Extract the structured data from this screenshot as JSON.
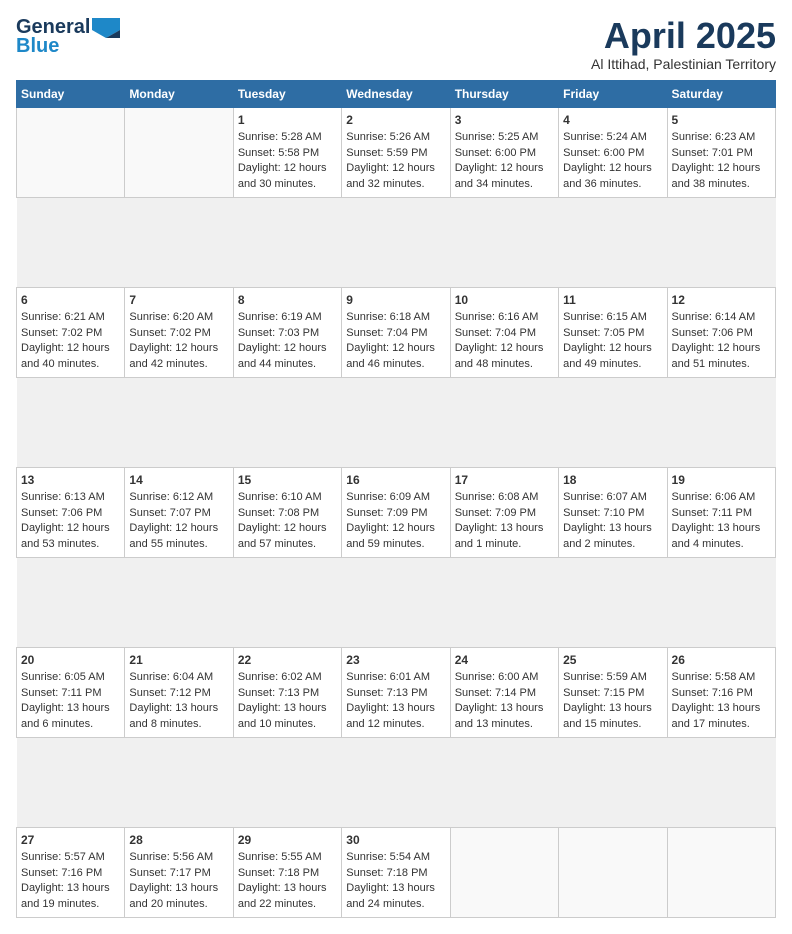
{
  "logo": {
    "general": "General",
    "blue": "Blue"
  },
  "title": "April 2025",
  "subtitle": "Al Ittihad, Palestinian Territory",
  "headers": [
    "Sunday",
    "Monday",
    "Tuesday",
    "Wednesday",
    "Thursday",
    "Friday",
    "Saturday"
  ],
  "weeks": [
    [
      {
        "day": "",
        "sunrise": "",
        "sunset": "",
        "daylight": ""
      },
      {
        "day": "",
        "sunrise": "",
        "sunset": "",
        "daylight": ""
      },
      {
        "day": "1",
        "sunrise": "Sunrise: 5:28 AM",
        "sunset": "Sunset: 5:58 PM",
        "daylight": "Daylight: 12 hours and 30 minutes."
      },
      {
        "day": "2",
        "sunrise": "Sunrise: 5:26 AM",
        "sunset": "Sunset: 5:59 PM",
        "daylight": "Daylight: 12 hours and 32 minutes."
      },
      {
        "day": "3",
        "sunrise": "Sunrise: 5:25 AM",
        "sunset": "Sunset: 6:00 PM",
        "daylight": "Daylight: 12 hours and 34 minutes."
      },
      {
        "day": "4",
        "sunrise": "Sunrise: 5:24 AM",
        "sunset": "Sunset: 6:00 PM",
        "daylight": "Daylight: 12 hours and 36 minutes."
      },
      {
        "day": "5",
        "sunrise": "Sunrise: 6:23 AM",
        "sunset": "Sunset: 7:01 PM",
        "daylight": "Daylight: 12 hours and 38 minutes."
      }
    ],
    [
      {
        "day": "6",
        "sunrise": "Sunrise: 6:21 AM",
        "sunset": "Sunset: 7:02 PM",
        "daylight": "Daylight: 12 hours and 40 minutes."
      },
      {
        "day": "7",
        "sunrise": "Sunrise: 6:20 AM",
        "sunset": "Sunset: 7:02 PM",
        "daylight": "Daylight: 12 hours and 42 minutes."
      },
      {
        "day": "8",
        "sunrise": "Sunrise: 6:19 AM",
        "sunset": "Sunset: 7:03 PM",
        "daylight": "Daylight: 12 hours and 44 minutes."
      },
      {
        "day": "9",
        "sunrise": "Sunrise: 6:18 AM",
        "sunset": "Sunset: 7:04 PM",
        "daylight": "Daylight: 12 hours and 46 minutes."
      },
      {
        "day": "10",
        "sunrise": "Sunrise: 6:16 AM",
        "sunset": "Sunset: 7:04 PM",
        "daylight": "Daylight: 12 hours and 48 minutes."
      },
      {
        "day": "11",
        "sunrise": "Sunrise: 6:15 AM",
        "sunset": "Sunset: 7:05 PM",
        "daylight": "Daylight: 12 hours and 49 minutes."
      },
      {
        "day": "12",
        "sunrise": "Sunrise: 6:14 AM",
        "sunset": "Sunset: 7:06 PM",
        "daylight": "Daylight: 12 hours and 51 minutes."
      }
    ],
    [
      {
        "day": "13",
        "sunrise": "Sunrise: 6:13 AM",
        "sunset": "Sunset: 7:06 PM",
        "daylight": "Daylight: 12 hours and 53 minutes."
      },
      {
        "day": "14",
        "sunrise": "Sunrise: 6:12 AM",
        "sunset": "Sunset: 7:07 PM",
        "daylight": "Daylight: 12 hours and 55 minutes."
      },
      {
        "day": "15",
        "sunrise": "Sunrise: 6:10 AM",
        "sunset": "Sunset: 7:08 PM",
        "daylight": "Daylight: 12 hours and 57 minutes."
      },
      {
        "day": "16",
        "sunrise": "Sunrise: 6:09 AM",
        "sunset": "Sunset: 7:09 PM",
        "daylight": "Daylight: 12 hours and 59 minutes."
      },
      {
        "day": "17",
        "sunrise": "Sunrise: 6:08 AM",
        "sunset": "Sunset: 7:09 PM",
        "daylight": "Daylight: 13 hours and 1 minute."
      },
      {
        "day": "18",
        "sunrise": "Sunrise: 6:07 AM",
        "sunset": "Sunset: 7:10 PM",
        "daylight": "Daylight: 13 hours and 2 minutes."
      },
      {
        "day": "19",
        "sunrise": "Sunrise: 6:06 AM",
        "sunset": "Sunset: 7:11 PM",
        "daylight": "Daylight: 13 hours and 4 minutes."
      }
    ],
    [
      {
        "day": "20",
        "sunrise": "Sunrise: 6:05 AM",
        "sunset": "Sunset: 7:11 PM",
        "daylight": "Daylight: 13 hours and 6 minutes."
      },
      {
        "day": "21",
        "sunrise": "Sunrise: 6:04 AM",
        "sunset": "Sunset: 7:12 PM",
        "daylight": "Daylight: 13 hours and 8 minutes."
      },
      {
        "day": "22",
        "sunrise": "Sunrise: 6:02 AM",
        "sunset": "Sunset: 7:13 PM",
        "daylight": "Daylight: 13 hours and 10 minutes."
      },
      {
        "day": "23",
        "sunrise": "Sunrise: 6:01 AM",
        "sunset": "Sunset: 7:13 PM",
        "daylight": "Daylight: 13 hours and 12 minutes."
      },
      {
        "day": "24",
        "sunrise": "Sunrise: 6:00 AM",
        "sunset": "Sunset: 7:14 PM",
        "daylight": "Daylight: 13 hours and 13 minutes."
      },
      {
        "day": "25",
        "sunrise": "Sunrise: 5:59 AM",
        "sunset": "Sunset: 7:15 PM",
        "daylight": "Daylight: 13 hours and 15 minutes."
      },
      {
        "day": "26",
        "sunrise": "Sunrise: 5:58 AM",
        "sunset": "Sunset: 7:16 PM",
        "daylight": "Daylight: 13 hours and 17 minutes."
      }
    ],
    [
      {
        "day": "27",
        "sunrise": "Sunrise: 5:57 AM",
        "sunset": "Sunset: 7:16 PM",
        "daylight": "Daylight: 13 hours and 19 minutes."
      },
      {
        "day": "28",
        "sunrise": "Sunrise: 5:56 AM",
        "sunset": "Sunset: 7:17 PM",
        "daylight": "Daylight: 13 hours and 20 minutes."
      },
      {
        "day": "29",
        "sunrise": "Sunrise: 5:55 AM",
        "sunset": "Sunset: 7:18 PM",
        "daylight": "Daylight: 13 hours and 22 minutes."
      },
      {
        "day": "30",
        "sunrise": "Sunrise: 5:54 AM",
        "sunset": "Sunset: 7:18 PM",
        "daylight": "Daylight: 13 hours and 24 minutes."
      },
      {
        "day": "",
        "sunrise": "",
        "sunset": "",
        "daylight": ""
      },
      {
        "day": "",
        "sunrise": "",
        "sunset": "",
        "daylight": ""
      },
      {
        "day": "",
        "sunrise": "",
        "sunset": "",
        "daylight": ""
      }
    ]
  ]
}
